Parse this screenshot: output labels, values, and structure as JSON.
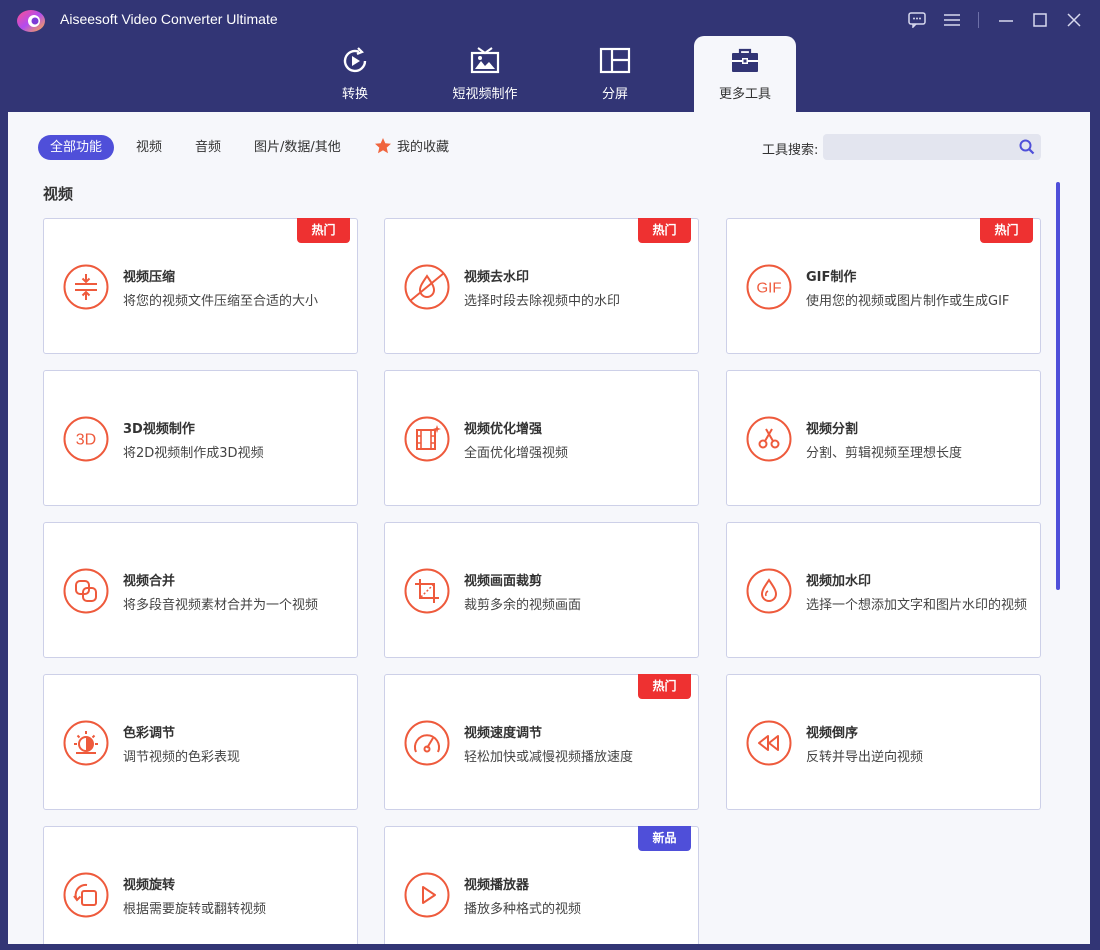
{
  "app": {
    "title": "Aiseesoft Video Converter Ultimate"
  },
  "tabs": [
    {
      "label": "转换",
      "icon": "convert-icon"
    },
    {
      "label": "短视频制作",
      "icon": "mv-icon"
    },
    {
      "label": "分屏",
      "icon": "collage-icon"
    },
    {
      "label": "更多工具",
      "icon": "toolbox-icon",
      "active": true
    }
  ],
  "filters": [
    {
      "label": "全部功能",
      "active": true
    },
    {
      "label": "视频"
    },
    {
      "label": "音频"
    },
    {
      "label": "图片/数据/其他"
    },
    {
      "label": "我的收藏",
      "icon": "star-icon"
    }
  ],
  "search": {
    "label": "工具搜索:",
    "placeholder": ""
  },
  "section": {
    "title": "视频"
  },
  "badges": {
    "hot": "热门",
    "new": "新品"
  },
  "tools": [
    {
      "title": "视频压缩",
      "desc": "将您的视频文件压缩至合适的大小",
      "badge": "热门",
      "icon": "compress-icon"
    },
    {
      "title": "视频去水印",
      "desc": "选择时段去除视频中的水印",
      "badge": "热门",
      "icon": "watermark-remove-icon"
    },
    {
      "title": "GIF制作",
      "desc": "使用您的视频或图片制作或生成GIF",
      "badge": "热门",
      "icon": "gif-icon"
    },
    {
      "title": "3D视频制作",
      "desc": "将2D视频制作成3D视频",
      "icon": "3d-icon"
    },
    {
      "title": "视频优化增强",
      "desc": "全面优化增强视频",
      "icon": "enhance-icon"
    },
    {
      "title": "视频分割",
      "desc": "分割、剪辑视频至理想长度",
      "icon": "scissors-icon"
    },
    {
      "title": "视频合并",
      "desc": "将多段音视频素材合并为一个视频",
      "icon": "merge-icon"
    },
    {
      "title": "视频画面裁剪",
      "desc": "裁剪多余的视频画面",
      "icon": "crop-icon"
    },
    {
      "title": "视频加水印",
      "desc": "选择一个想添加文字和图片水印的视频",
      "icon": "watermark-add-icon"
    },
    {
      "title": "色彩调节",
      "desc": "调节视频的色彩表现",
      "icon": "color-icon"
    },
    {
      "title": "视频速度调节",
      "desc": "轻松加快或减慢视频播放速度",
      "badge": "热门",
      "icon": "speed-icon"
    },
    {
      "title": "视频倒序",
      "desc": "反转并导出逆向视频",
      "icon": "reverse-icon"
    },
    {
      "title": "视频旋转",
      "desc": "根据需要旋转或翻转视频",
      "icon": "rotate-icon"
    },
    {
      "title": "视频播放器",
      "desc": "播放多种格式的视频",
      "badge": "新品",
      "icon": "play-icon"
    }
  ],
  "colors": {
    "accent": "#4f4fd9",
    "brand_bg": "#323575",
    "icon": "#ee5a3c",
    "hot": "#ee3131"
  }
}
